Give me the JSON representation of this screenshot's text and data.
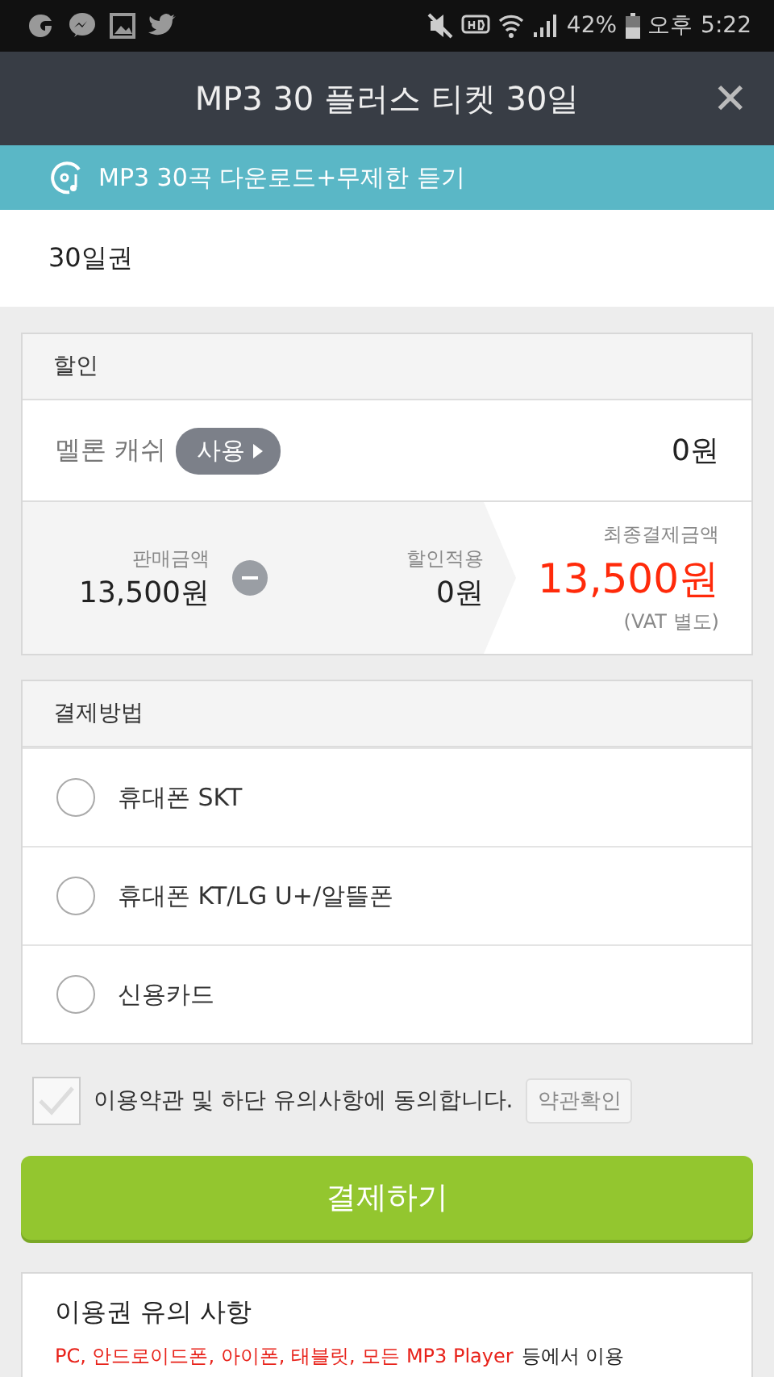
{
  "status_bar": {
    "battery": "42%",
    "period": "오후",
    "time": "5:22"
  },
  "header": {
    "title": "MP3 30 플러스 티켓 30일",
    "close": "✕"
  },
  "banner": {
    "text": "MP3 30곡 다운로드+무제한 듣기"
  },
  "ticket": {
    "name": "30일권"
  },
  "discount": {
    "title": "할인",
    "cash_label": "멜론 캐쉬",
    "use_button": "사용",
    "cash_value": "0원",
    "sale_label": "판매금액",
    "sale_value": "13,500원",
    "applied_label": "할인적용",
    "applied_value": "0원",
    "final_label": "최종결제금액",
    "final_value": "13,500원",
    "vat": "(VAT 별도)"
  },
  "payment": {
    "title": "결제방법",
    "options": [
      {
        "label": "휴대폰 SKT",
        "selected": false
      },
      {
        "label": "휴대폰 KT/LG U+/알뜰폰",
        "selected": false
      },
      {
        "label": "신용카드",
        "selected": false
      }
    ]
  },
  "agree": {
    "text": "이용약관 및 하단 유의사항에 동의합니다.",
    "checked": false,
    "terms_button": "약관확인"
  },
  "pay_button": "결제하기",
  "notice": {
    "title": "이용권 유의 사항",
    "line_red": "PC, 안드로이드폰, 아이폰, 태블릿, 모든 MP3 Player",
    "line_rest": "등에서 이용"
  }
}
